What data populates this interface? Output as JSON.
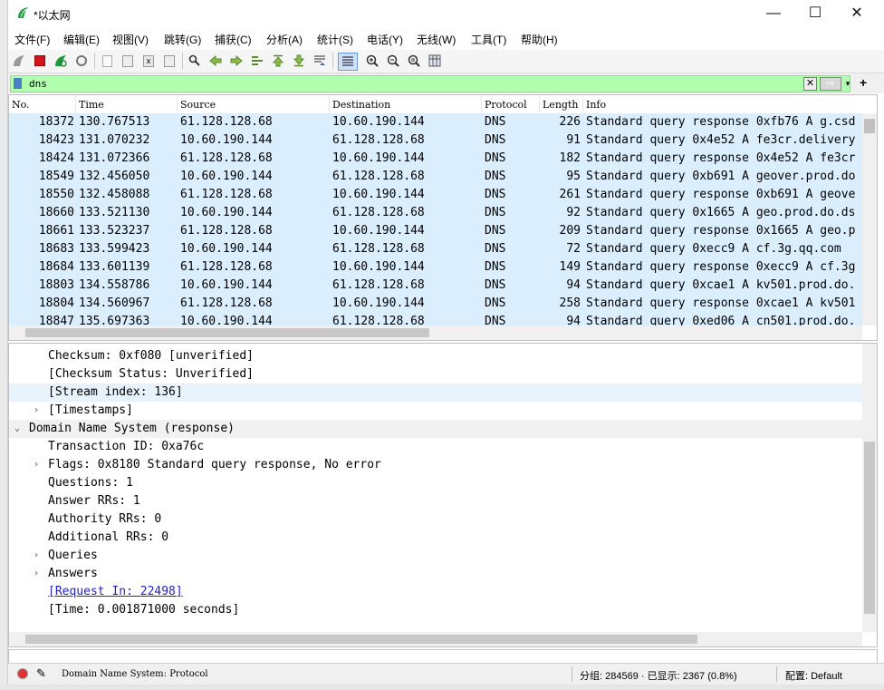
{
  "window": {
    "title": "*以太网",
    "min": "—",
    "max": "☐",
    "close": "✕"
  },
  "menu": [
    "文件(F)",
    "编辑(E)",
    "视图(V)",
    "跳转(G)",
    "捕获(C)",
    "分析(A)",
    "统计(S)",
    "电话(Y)",
    "无线(W)",
    "工具(T)",
    "帮助(H)"
  ],
  "filter": {
    "value": "dns",
    "clear": "✕",
    "apply": "⇨",
    "dropdown": "▾",
    "add": "+"
  },
  "packet_list": {
    "columns": [
      "No.",
      "Time",
      "Source",
      "Destination",
      "Protocol",
      "Length",
      "Info"
    ],
    "rows": [
      [
        "18372",
        "130.767513",
        "61.128.128.68",
        "10.60.190.144",
        "DNS",
        "226",
        "Standard query response 0xfb76 A g.csd"
      ],
      [
        "18423",
        "131.070232",
        "10.60.190.144",
        "61.128.128.68",
        "DNS",
        "91",
        "Standard query 0x4e52 A fe3cr.delivery"
      ],
      [
        "18424",
        "131.072366",
        "61.128.128.68",
        "10.60.190.144",
        "DNS",
        "182",
        "Standard query response 0x4e52 A fe3cr"
      ],
      [
        "18549",
        "132.456050",
        "10.60.190.144",
        "61.128.128.68",
        "DNS",
        "95",
        "Standard query 0xb691 A geover.prod.do"
      ],
      [
        "18550",
        "132.458088",
        "61.128.128.68",
        "10.60.190.144",
        "DNS",
        "261",
        "Standard query response 0xb691 A geove"
      ],
      [
        "18660",
        "133.521130",
        "10.60.190.144",
        "61.128.128.68",
        "DNS",
        "92",
        "Standard query 0x1665 A geo.prod.do.ds"
      ],
      [
        "18661",
        "133.523237",
        "61.128.128.68",
        "10.60.190.144",
        "DNS",
        "209",
        "Standard query response 0x1665 A geo.p"
      ],
      [
        "18683",
        "133.599423",
        "10.60.190.144",
        "61.128.128.68",
        "DNS",
        "72",
        "Standard query 0xecc9 A cf.3g.qq.com"
      ],
      [
        "18684",
        "133.601139",
        "61.128.128.68",
        "10.60.190.144",
        "DNS",
        "149",
        "Standard query response 0xecc9 A cf.3g"
      ],
      [
        "18803",
        "134.558786",
        "10.60.190.144",
        "61.128.128.68",
        "DNS",
        "94",
        "Standard query 0xcae1 A kv501.prod.do."
      ],
      [
        "18804",
        "134.560967",
        "61.128.128.68",
        "10.60.190.144",
        "DNS",
        "258",
        "Standard query response 0xcae1 A kv501"
      ],
      [
        "18847",
        "135.697363",
        "10.60.190.144",
        "61.128.128.68",
        "DNS",
        "94",
        "Standard query 0xed06 A cn501.prod.do."
      ]
    ]
  },
  "details": [
    {
      "text": "Checksum: 0xf080 [unverified]",
      "indent": 1,
      "arrow": ""
    },
    {
      "text": "[Checksum Status: Unverified]",
      "indent": 1,
      "arrow": ""
    },
    {
      "text": "[Stream index: 136]",
      "indent": 1,
      "arrow": "",
      "selected": true
    },
    {
      "text": "[Timestamps]",
      "indent": 1,
      "arrow": "›"
    },
    {
      "text": "Domain Name System (response)",
      "indent": 0,
      "arrow": "⌄",
      "header": true
    },
    {
      "text": "Transaction ID: 0xa76c",
      "indent": 1,
      "arrow": ""
    },
    {
      "text": "Flags: 0x8180 Standard query response, No error",
      "indent": 1,
      "arrow": "›"
    },
    {
      "text": "Questions: 1",
      "indent": 1,
      "arrow": ""
    },
    {
      "text": "Answer RRs: 1",
      "indent": 1,
      "arrow": ""
    },
    {
      "text": "Authority RRs: 0",
      "indent": 1,
      "arrow": ""
    },
    {
      "text": "Additional RRs: 0",
      "indent": 1,
      "arrow": ""
    },
    {
      "text": "Queries",
      "indent": 1,
      "arrow": "›"
    },
    {
      "text": "Answers",
      "indent": 1,
      "arrow": "›"
    },
    {
      "text": "[Request In: 22498]",
      "indent": 1,
      "arrow": "",
      "link": true
    },
    {
      "text": "[Time: 0.001871000 seconds]",
      "indent": 1,
      "arrow": ""
    }
  ],
  "status": {
    "text": "Domain Name System: Protocol",
    "packets": "分组: 284569 · 已显示: 2367 (0.8%)",
    "profile": "配置: Default",
    "edit_icon": "✎"
  },
  "colors": {
    "row_bg": "#daeefe",
    "filter_bg": "#afffaf",
    "link": "#2222cc"
  }
}
